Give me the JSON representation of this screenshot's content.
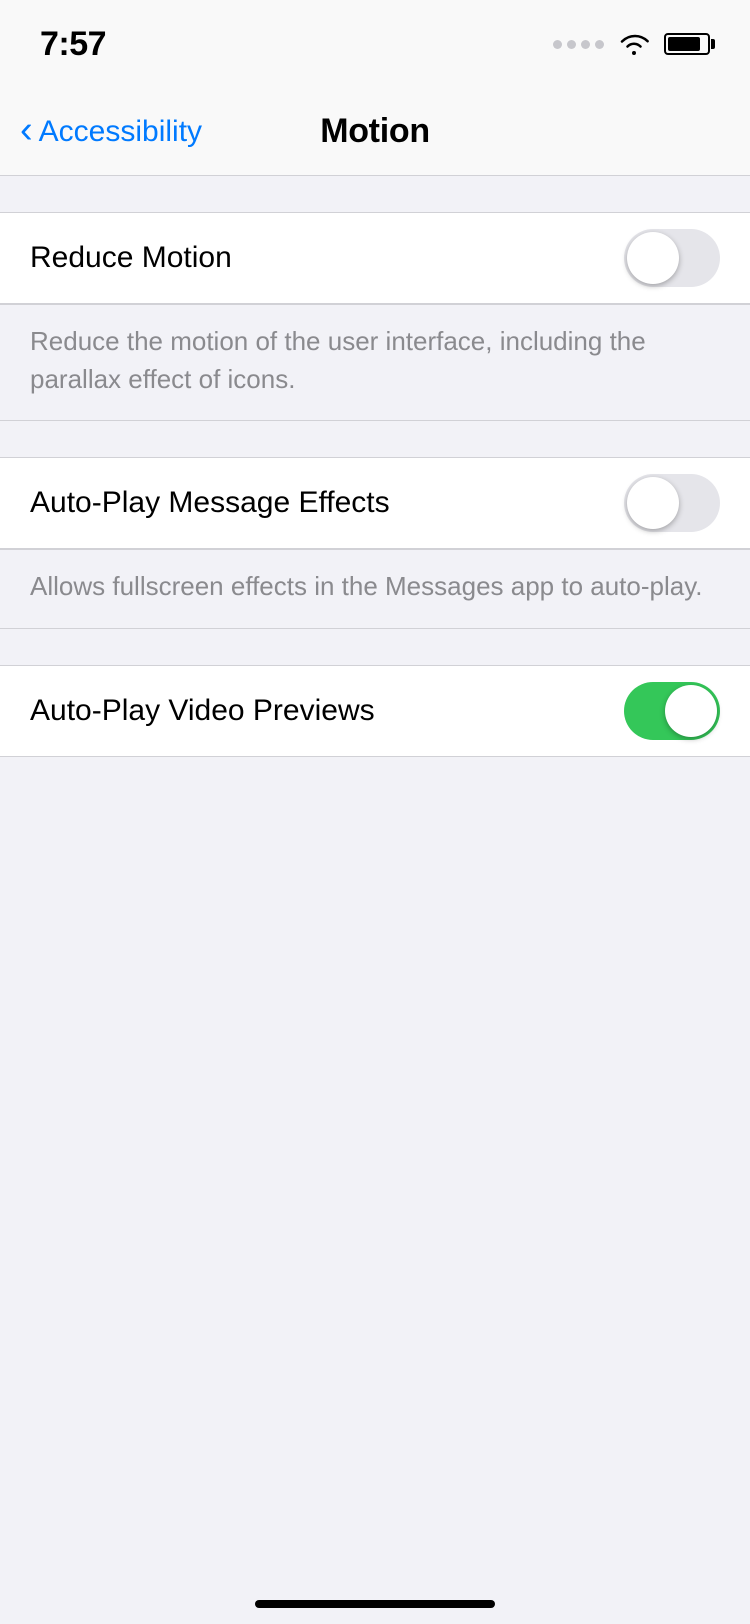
{
  "statusBar": {
    "time": "7:57"
  },
  "navBar": {
    "backLabel": "Accessibility",
    "title": "Motion"
  },
  "settings": {
    "groups": [
      {
        "rows": [
          {
            "id": "reduce-motion",
            "label": "Reduce Motion",
            "toggleOn": false,
            "description": "Reduce the motion of the user interface, including the parallax effect of icons."
          }
        ]
      },
      {
        "rows": [
          {
            "id": "auto-play-message",
            "label": "Auto-Play Message Effects",
            "toggleOn": false,
            "description": "Allows fullscreen effects in the Messages app to auto-play."
          }
        ]
      },
      {
        "rows": [
          {
            "id": "auto-play-video",
            "label": "Auto-Play Video Previews",
            "toggleOn": true,
            "description": null
          }
        ]
      }
    ]
  }
}
